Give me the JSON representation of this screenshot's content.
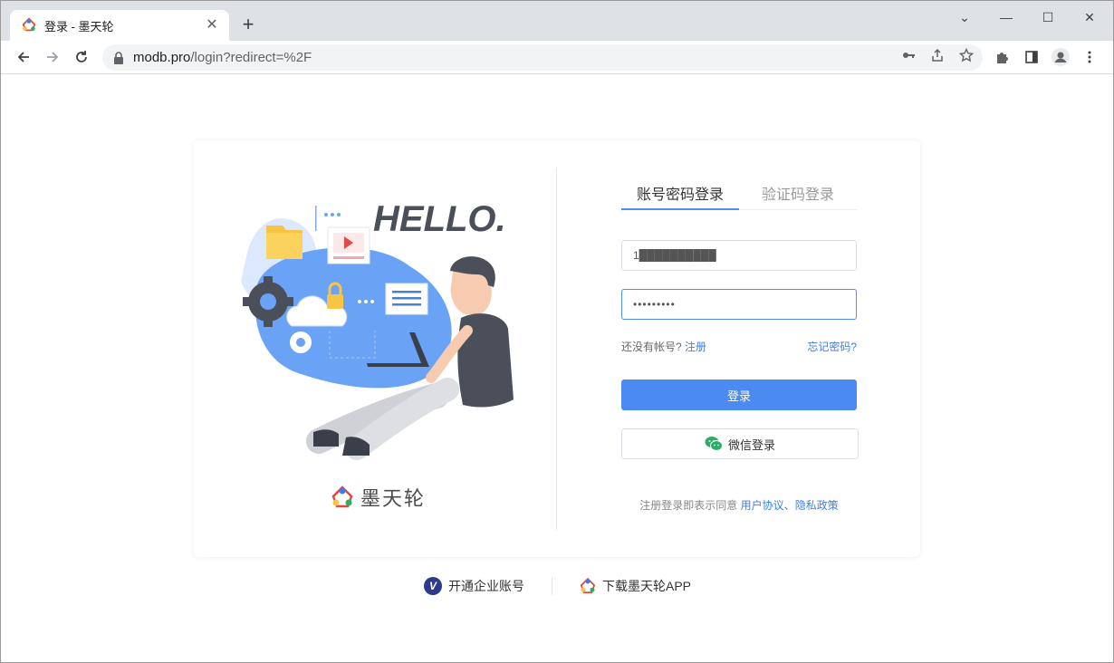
{
  "browser": {
    "tab_title": "登录 - 墨天轮",
    "tab_close": "✕",
    "new_tab": "+",
    "url_host": "modb.pro",
    "url_path": "/login?redirect=%2F",
    "controls": {
      "dropdown": "⌄",
      "minimize": "—",
      "maximize": "☐",
      "close": "✕"
    }
  },
  "login": {
    "tabs": [
      {
        "label": "账号密码登录",
        "active": true
      },
      {
        "label": "验证码登录",
        "active": false
      }
    ],
    "username_value": "1██████████",
    "password_value": "•••••••••",
    "no_account_text": "还没有帐号?",
    "register_link": "注册",
    "forgot_link": "忘记密码?",
    "login_button": "登录",
    "wechat_button": "微信登录",
    "agree_text": "注册登录即表示同意",
    "user_agreement": "用户协议",
    "separator": "、",
    "privacy_policy": "隐私政策"
  },
  "illustration": {
    "hello_text": "HELLO."
  },
  "brand": {
    "name": "墨天轮"
  },
  "footer": {
    "enterprise_badge": "V",
    "enterprise_label": "开通企业账号",
    "app_label": "下载墨天轮APP"
  },
  "colors": {
    "primary": "#4b8af1",
    "link": "#3d7ee8",
    "blob": "#6aa3f5",
    "folder": "#f9c445",
    "wechat": "#2aae67"
  }
}
